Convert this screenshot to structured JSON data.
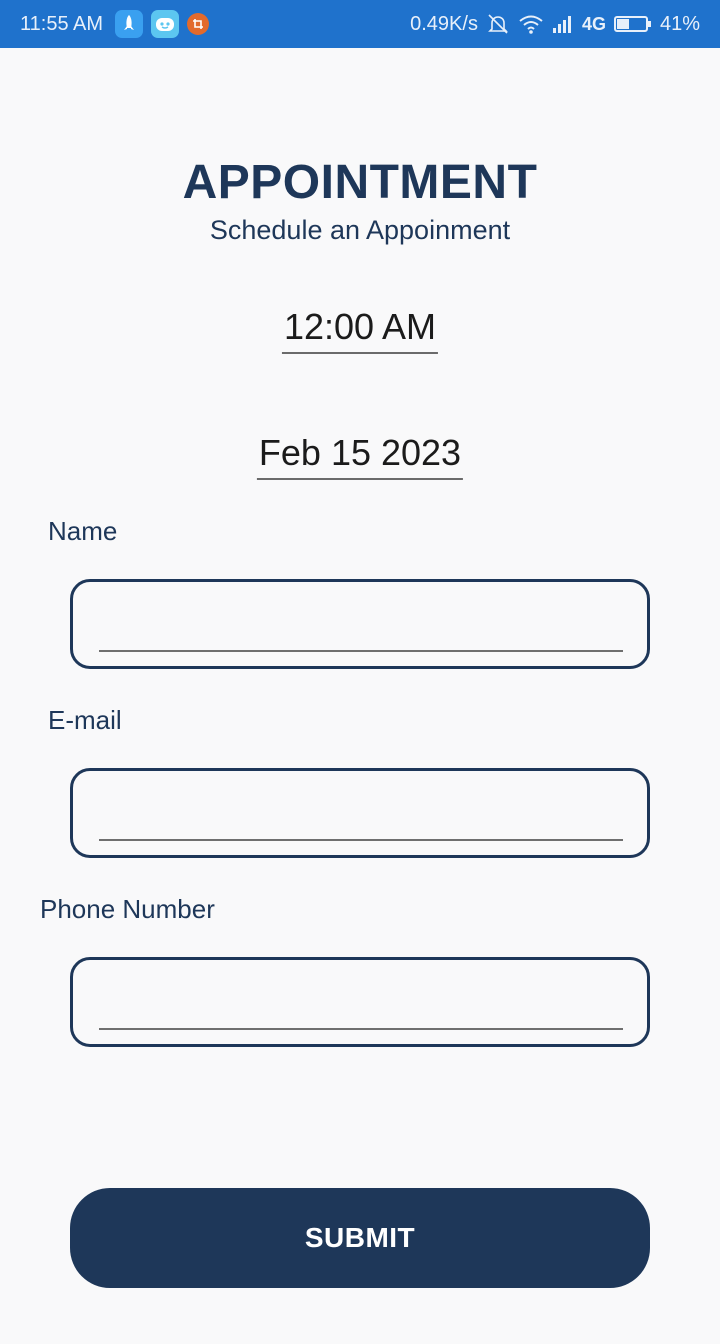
{
  "status_bar": {
    "time": "11:55 AM",
    "speed": "0.49K/s",
    "network": "4G",
    "battery": "41%",
    "battery_level": 0.41,
    "notification_icons": [
      "rocket-app-icon",
      "robot-app-icon",
      "crop-app-icon"
    ],
    "indicator_icons": [
      "mute-bell-icon",
      "wifi-icon",
      "signal-icon",
      "battery-icon"
    ]
  },
  "header": {
    "title": "APPOINTMENT",
    "subtitle": "Schedule an Appoinment"
  },
  "schedule": {
    "time": "12:00 AM",
    "date": "Feb 15 2023"
  },
  "form": {
    "name_label": "Name",
    "name_value": "",
    "email_label": "E-mail",
    "email_value": "",
    "phone_label": "Phone Number",
    "phone_value": ""
  },
  "submit_label": "SUBMIT",
  "colors": {
    "status_bar": "#1f72cc",
    "primary": "#1e3759",
    "background": "#f9f9fa"
  }
}
